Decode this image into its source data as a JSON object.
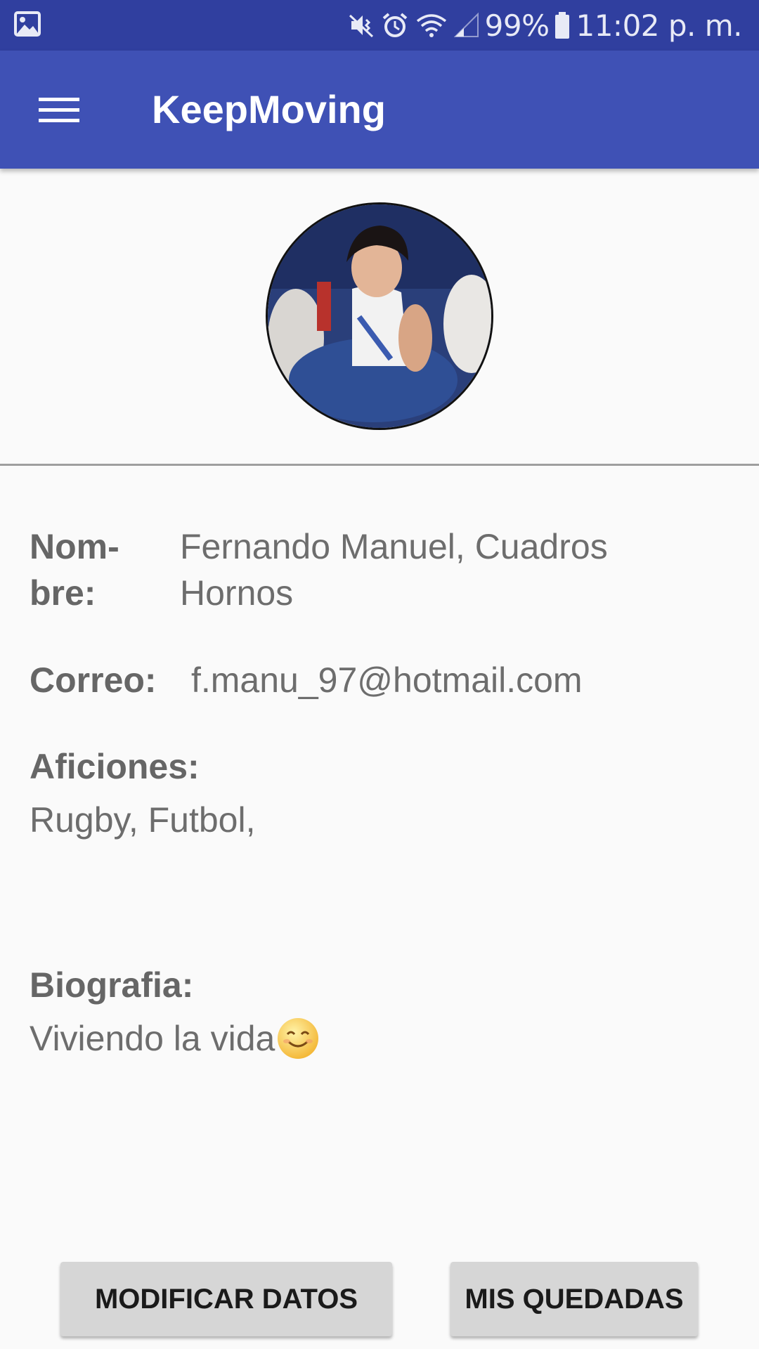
{
  "status_bar": {
    "battery": "99%",
    "time": "11:02 p. m."
  },
  "app_bar": {
    "title": "KeepMoving"
  },
  "profile": {
    "name_label": "Nom-\nbre:",
    "name_value": "Fernando Manuel, Cuadros\nHornos",
    "email_label": "Correo:",
    "email_value": "f.manu_97@hotmail.com",
    "hobbies_label": "Aficiones:",
    "hobbies_value": "Rugby, Futbol,",
    "bio_label": "Biografia:",
    "bio_value": "Viviendo la vida"
  },
  "buttons": {
    "edit": "MODIFICAR DATOS",
    "meetups": "MIS QUEDADAS"
  },
  "colors": {
    "status_bar": "#303f9f",
    "app_bar": "#3f51b5",
    "background": "#fafafa"
  }
}
